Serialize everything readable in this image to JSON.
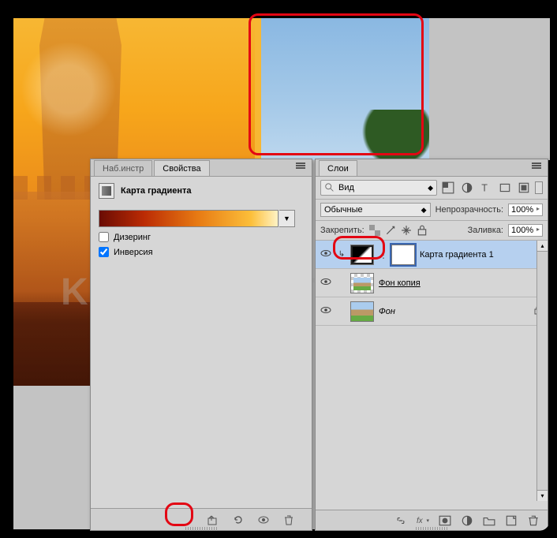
{
  "watermark": "KAK-SDELAT-VSE",
  "properties_panel": {
    "tabs": {
      "tab1": "Наб.инстр",
      "tab2": "Свойства"
    },
    "title": "Карта градиента",
    "dither_label": "Дизеринг",
    "reverse_label": "Инверсия",
    "dither_checked": false,
    "reverse_checked": true
  },
  "layers_panel": {
    "tab": "Слои",
    "filter_label": "Вид",
    "blend_mode": "Обычные",
    "opacity_label": "Непрозрачность:",
    "opacity_value": "100%",
    "lock_label": "Закрепить:",
    "fill_label": "Заливка:",
    "fill_value": "100%",
    "layers": [
      {
        "name": "Карта градиента 1",
        "clipped": true,
        "type": "adjustment",
        "underline": false,
        "locked": false
      },
      {
        "name": "Фон копия",
        "clipped": false,
        "type": "img-copy",
        "underline": true,
        "locked": false
      },
      {
        "name": "Фон",
        "clipped": false,
        "type": "img",
        "underline": false,
        "locked": true
      }
    ]
  }
}
